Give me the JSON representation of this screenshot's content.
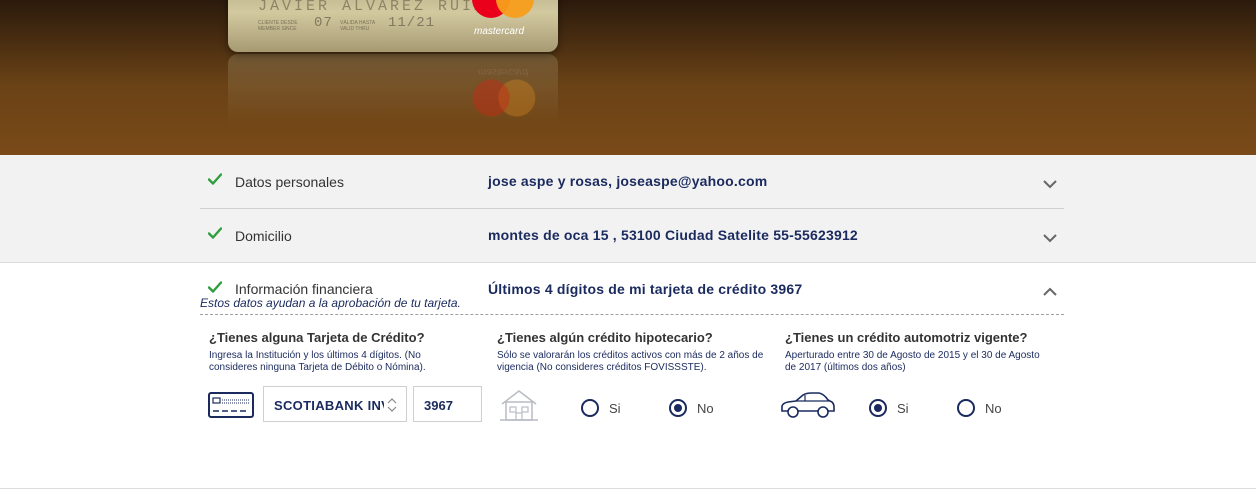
{
  "hero": {
    "card": {
      "holder_name": "JAVIER ALVAREZ RUIZ",
      "member_since_label": "CLIENTE DESDE\nMEMBER SINCE",
      "member_since_value": "07",
      "valid_label": "VÁLIDA HASTA\nVALID THRU",
      "valid_value": "11/21",
      "brand": "mastercard"
    }
  },
  "sections": [
    {
      "title": "Datos personales",
      "value": "jose aspe y rosas, joseaspe@yahoo.com",
      "expanded": false
    },
    {
      "title": "Domicilio",
      "value": "montes de oca 15 , 53100 Ciudad Satelite 55-55623912",
      "expanded": false
    },
    {
      "title": "Información financiera",
      "value": "Últimos 4 dígitos de mi tarjeta de crédito 3967",
      "expanded": true
    }
  ],
  "financial": {
    "note": "Estos datos ayudan a la aprobación de tu tarjeta.",
    "credit_card": {
      "question": "¿Tienes alguna Tarjeta de Crédito?",
      "help": "Ingresa la Institución y los últimos 4 dígitos. (No consideres ninguna Tarjeta de Débito o Nómina).",
      "institution": "SCOTIABANK INVERLAT",
      "last_digits": "3967"
    },
    "mortgage": {
      "question": "¿Tienes algún crédito hipotecario?",
      "help": "Sólo se valorarán los créditos activos con más de 2 años de vigencia (No consideres créditos FOVISSSTE).",
      "options": [
        "Si",
        "No"
      ],
      "selected": "No"
    },
    "auto": {
      "question": "¿Tienes un crédito automotriz vigente?",
      "help": "Aperturado entre 30 de Agosto de 2015 y el 30 de Agosto de 2017 (últimos dos años)",
      "options": [
        "Si",
        "No"
      ],
      "selected": "Si"
    }
  },
  "colors": {
    "navy": "#1a2a5e",
    "check_green": "#2e9e3e",
    "band_gray": "#f2f2f2"
  }
}
